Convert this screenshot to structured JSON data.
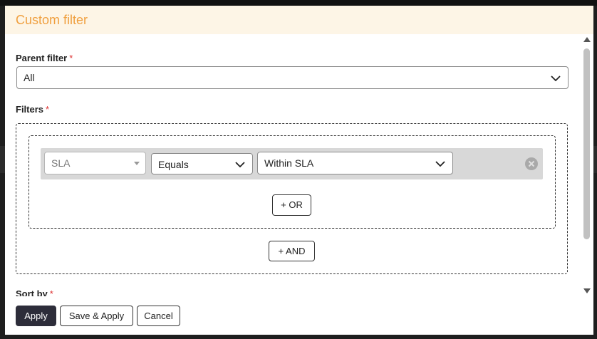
{
  "dialog": {
    "title": "Custom filter"
  },
  "parent_filter": {
    "label": "Parent filter",
    "required_mark": "*",
    "value": "All"
  },
  "filters": {
    "label": "Filters",
    "required_mark": "*",
    "rule": {
      "field": "SLA",
      "operator": "Equals",
      "value": "Within SLA"
    },
    "or_button": "+ OR",
    "and_button": "+ AND"
  },
  "sort_by": {
    "label": "Sort by",
    "required_mark": "*"
  },
  "footer": {
    "apply": "Apply",
    "save_apply": "Save & Apply",
    "cancel": "Cancel"
  },
  "colors": {
    "header_bg": "#fdf5e6",
    "title": "#f0a040",
    "required": "#d33333",
    "primary_button": "#2d2d3a"
  }
}
